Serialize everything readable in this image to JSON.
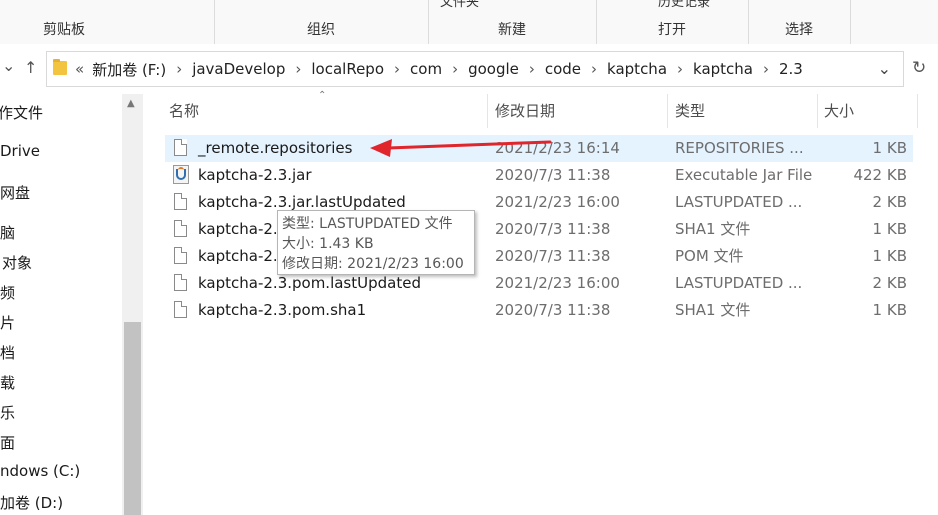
{
  "ribbon": {
    "groups": [
      "剪贴板",
      "组织",
      "新建",
      "打开",
      "选择"
    ],
    "top_partial": [
      "文件夹",
      "历史记录"
    ]
  },
  "address": {
    "overflow": "«",
    "crumbs": [
      "新加卷 (F:)",
      "javaDevelop",
      "localRepo",
      "com",
      "google",
      "code",
      "kaptcha",
      "kaptcha",
      "2.3"
    ]
  },
  "nav_pane": {
    "items": [
      "作文件",
      "Drive",
      "网盘",
      "脑",
      "对象",
      "频",
      "片",
      "档",
      "载",
      "乐",
      "面",
      "ndows (C:)",
      "加卷 (D:)"
    ]
  },
  "columns": {
    "name": "名称",
    "date": "修改日期",
    "type": "类型",
    "size": "大小"
  },
  "files": [
    {
      "name": "_remote.repositories",
      "date": "2021/2/23 16:14",
      "type": "REPOSITORIES ...",
      "size": "1 KB",
      "icon": "file-icon",
      "selected": true
    },
    {
      "name": "kaptcha-2.3.jar",
      "date": "2020/7/3 11:38",
      "type": "Executable Jar File",
      "size": "422 KB",
      "icon": "jar-icon",
      "selected": false
    },
    {
      "name": "kaptcha-2.3.jar.lastUpdated",
      "date": "2021/2/23 16:00",
      "type": "LASTUPDATED ...",
      "size": "2 KB",
      "icon": "file-icon",
      "selected": false
    },
    {
      "name": "kaptcha-2.3.jar.sha1",
      "date": "2020/7/3 11:38",
      "type": "SHA1 文件",
      "size": "1 KB",
      "icon": "file-icon",
      "selected": false
    },
    {
      "name": "kaptcha-2.3.pom",
      "date": "2020/7/3 11:38",
      "type": "POM 文件",
      "size": "1 KB",
      "icon": "file-icon",
      "selected": false
    },
    {
      "name": "kaptcha-2.3.pom.lastUpdated",
      "date": "2021/2/23 16:00",
      "type": "LASTUPDATED ...",
      "size": "2 KB",
      "icon": "file-icon",
      "selected": false
    },
    {
      "name": "kaptcha-2.3.pom.sha1",
      "date": "2020/7/3 11:38",
      "type": "SHA1 文件",
      "size": "1 KB",
      "icon": "file-icon",
      "selected": false
    }
  ],
  "tooltip": {
    "type_line": "类型: LASTUPDATED 文件",
    "size_line": "大小: 1.43 KB",
    "date_line": "修改日期: 2021/2/23 16:00"
  },
  "annotation": {
    "arrow_color": "#e0262c"
  }
}
